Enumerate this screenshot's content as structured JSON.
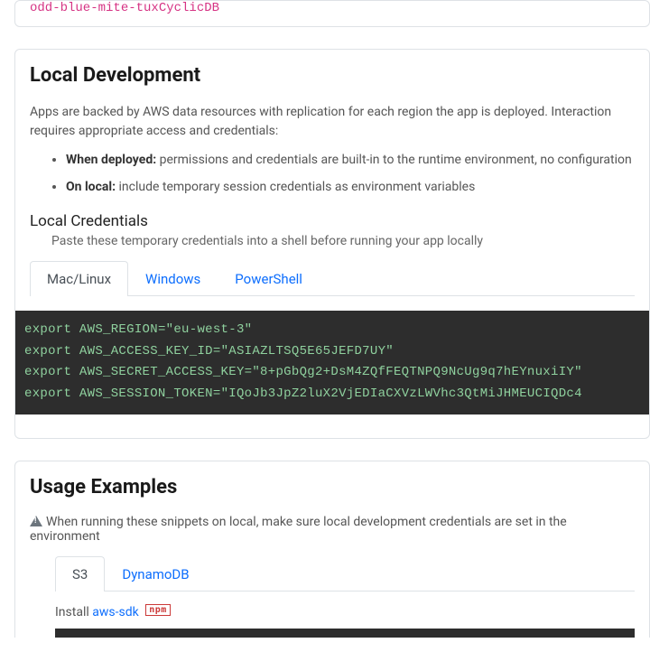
{
  "top_code": "odd-blue-mite-tuxCyclicDB",
  "local_dev": {
    "title": "Local Development",
    "intro": "Apps are backed by AWS data resources with replication for each region the app is deployed. Interaction requires appropriate access and credentials:",
    "bullets": [
      {
        "label": "When deployed:",
        "text": " permissions and credentials are built-in to the runtime environment, no configuration"
      },
      {
        "label": "On local:",
        "text": " include temporary session credentials as environment variables"
      }
    ],
    "creds_title": "Local Credentials",
    "creds_desc": "Paste these temporary credentials into a shell before running your app locally",
    "tabs": [
      "Mac/Linux",
      "Windows",
      "PowerShell"
    ],
    "exports": [
      {
        "cmd": "export",
        "var": "AWS_REGION",
        "val": "\"eu-west-3\""
      },
      {
        "cmd": "export",
        "var": "AWS_ACCESS_KEY_ID",
        "val": "\"ASIAZLTSQ5E65JEFD7UY\""
      },
      {
        "cmd": "export",
        "var": "AWS_SECRET_ACCESS_KEY",
        "val": "\"8+pGbQg2+DsM4ZQfFEQTNPQ9NcUg9q7hEYnuxiIY\""
      },
      {
        "cmd": "export",
        "var": "AWS_SESSION_TOKEN",
        "val": "\"IQoJb3JpZ2luX2VjEDIaCXVzLWVhc3QtMiJHMEUCIQDc4"
      }
    ]
  },
  "usage": {
    "title": "Usage Examples",
    "warning": "When running these snippets on local, make sure local development credentials are set in the environment",
    "tabs": [
      "S3",
      "DynamoDB"
    ],
    "install_prefix": "Install ",
    "install_link": "aws-sdk",
    "npm_label": "npm"
  }
}
